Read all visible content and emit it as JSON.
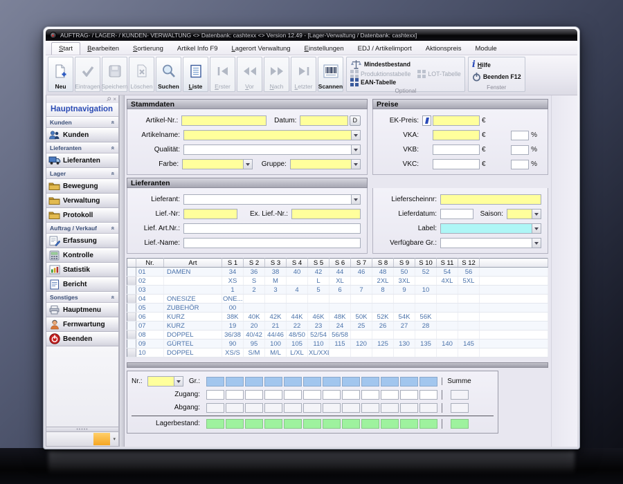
{
  "window": {
    "title": "AUFTRAG- / LAGER- / KUNDEN- VERWALTUNG <> Datenbank: cashtexx <> Version 12.49 - [Lager-Verwaltung / Datenbank: cashtexx]"
  },
  "ribbon": {
    "tabs": [
      {
        "label": "Start",
        "accel": true,
        "active": true
      },
      {
        "label": "Bearbeiten",
        "accel": true
      },
      {
        "label": "Sortierung",
        "accel": true
      },
      {
        "label": "Artikel Info F9"
      },
      {
        "label": "Lagerort Verwaltung",
        "accel": true
      },
      {
        "label": "Einstellungen",
        "accel": true
      },
      {
        "label": "EDJ / Artikelimport"
      },
      {
        "label": "Aktionspreis"
      },
      {
        "label": "Module"
      }
    ],
    "buttons": [
      {
        "label": "Neu",
        "icon": "new-page-icon",
        "enabled": true
      },
      {
        "label": "Eintragen",
        "icon": "checkmark-icon",
        "enabled": false
      },
      {
        "label": "Speichern",
        "icon": "floppy-icon",
        "enabled": false
      },
      {
        "label": "Löschen",
        "icon": "delete-page-icon",
        "enabled": false
      },
      {
        "label": "Suchen",
        "icon": "magnifier-icon",
        "enabled": true
      },
      {
        "label": "Liste",
        "icon": "list-icon",
        "enabled": true,
        "accel": true
      },
      {
        "label": "Erster",
        "icon": "first-icon",
        "enabled": false,
        "accel": true
      },
      {
        "label": "Vor",
        "icon": "prev-icon",
        "enabled": false,
        "accel": true
      },
      {
        "label": "Nach",
        "icon": "next-icon",
        "enabled": false,
        "accel": true
      },
      {
        "label": "Letzter",
        "icon": "last-icon",
        "enabled": false,
        "accel": true
      },
      {
        "label": "Scannen",
        "icon": "barcode-icon",
        "enabled": true
      }
    ],
    "optional_group": {
      "caption": "Optional",
      "items": [
        {
          "label": "Mindestbestand",
          "icon": "scale-icon",
          "enabled": true
        },
        {
          "label": "Produktionstabelle",
          "icon": "grid-icon",
          "enabled": false
        },
        {
          "label": "LOT-Tabelle",
          "icon": "grid-icon",
          "enabled": false
        },
        {
          "label": "EAN-Tabelle",
          "icon": "grid-icon",
          "enabled": true
        }
      ]
    },
    "fenster_group": {
      "caption": "Fenster",
      "items": [
        {
          "label": "Hilfe",
          "icon": "info-icon",
          "accel": true
        },
        {
          "label": "Beenden F12",
          "icon": "power-icon"
        }
      ]
    }
  },
  "sidebar": {
    "title": "Hauptnavigation",
    "groups": [
      {
        "label": "Kunden",
        "items": [
          {
            "label": "Kunden",
            "icon": "people-icon"
          }
        ]
      },
      {
        "label": "Lieferanten",
        "items": [
          {
            "label": "Lieferanten",
            "icon": "truck-icon"
          }
        ]
      },
      {
        "label": "Lager",
        "items": [
          {
            "label": "Bewegung",
            "icon": "folder-icon"
          },
          {
            "label": "Verwaltung",
            "icon": "folder-icon"
          },
          {
            "label": "Protokoll",
            "icon": "folder-icon"
          }
        ]
      },
      {
        "label": "Auftrag / Verkauf",
        "items": [
          {
            "label": "Erfassung",
            "icon": "note-icon"
          },
          {
            "label": "Kontrolle",
            "icon": "calculator-icon"
          },
          {
            "label": "Statistik",
            "icon": "chart-icon"
          },
          {
            "label": "Bericht",
            "icon": "report-icon"
          }
        ]
      },
      {
        "label": "Sonstiges",
        "items": [
          {
            "label": "Hauptmenu",
            "icon": "printer-icon"
          },
          {
            "label": "Fernwartung",
            "icon": "support-icon"
          },
          {
            "label": "Beenden",
            "icon": "power-red-icon"
          }
        ]
      }
    ]
  },
  "form": {
    "stammdaten": {
      "title": "Stammdaten",
      "artikel_nr_label": "Artikel-Nr.:",
      "datum_label": "Datum:",
      "datum_button": "D",
      "artikelname_label": "Artikelname:",
      "qualitaet_label": "Qualität:",
      "farbe_label": "Farbe:",
      "gruppe_label": "Gruppe:"
    },
    "preise": {
      "title": "Preise",
      "ek_label": "EK-Preis:",
      "vka_label": "VKA:",
      "vkb_label": "VKB:",
      "vkc_label": "VKC:",
      "currency": "€",
      "percent": "%"
    },
    "lieferanten": {
      "title": "Lieferanten",
      "lieferant_label": "Lieferant:",
      "lief_nr_label": "Lief.-Nr:",
      "ex_lief_nr_label": "Ex. Lief.-Nr.:",
      "lief_art_nr_label": "Lief. Art.Nr.:",
      "lief_name_label": "Lief.-Name:"
    },
    "liefer_details": {
      "lieferschein_label": "Lieferscheinnr:",
      "lieferdatum_label": "Lieferdatum:",
      "saison_label": "Saison:",
      "label_label": "Label:",
      "verfuegbare_label": "Verfügbare Gr.:"
    }
  },
  "table": {
    "columns": [
      "Nr.",
      "Art",
      "S 1",
      "S 2",
      "S 3",
      "S 4",
      "S 5",
      "S 6",
      "S 7",
      "S 8",
      "S 9",
      "S 10",
      "S 11",
      "S 12"
    ],
    "rows": [
      {
        "nr": "01",
        "art": "DAMEN",
        "sizes": [
          "34",
          "36",
          "38",
          "40",
          "42",
          "44",
          "46",
          "48",
          "50",
          "52",
          "54",
          "56"
        ]
      },
      {
        "nr": "02",
        "art": "",
        "sizes": [
          "XS",
          "S",
          "M",
          "",
          "L",
          "XL",
          "",
          "2XL",
          "3XL",
          "",
          "4XL",
          "5XL"
        ]
      },
      {
        "nr": "03",
        "art": "",
        "sizes": [
          "1",
          "2",
          "3",
          "4",
          "5",
          "6",
          "7",
          "8",
          "9",
          "10",
          "",
          ""
        ]
      },
      {
        "nr": "04",
        "art": "ONESIZE",
        "sizes": [
          "ONE...",
          "",
          "",
          "",
          "",
          "",
          "",
          "",
          "",
          "",
          "",
          ""
        ]
      },
      {
        "nr": "05",
        "art": "ZUBEHÖR",
        "sizes": [
          "00",
          "",
          "",
          "",
          "",
          "",
          "",
          "",
          "",
          "",
          "",
          ""
        ]
      },
      {
        "nr": "06",
        "art": "KURZ",
        "sizes": [
          "38K",
          "40K",
          "42K",
          "44K",
          "46K",
          "48K",
          "50K",
          "52K",
          "54K",
          "56K",
          "",
          ""
        ]
      },
      {
        "nr": "07",
        "art": "KURZ",
        "sizes": [
          "19",
          "20",
          "21",
          "22",
          "23",
          "24",
          "25",
          "26",
          "27",
          "28",
          "",
          ""
        ]
      },
      {
        "nr": "08",
        "art": "DOPPEL",
        "sizes": [
          "36/38",
          "40/42",
          "44/46",
          "48/50",
          "52/54",
          "56/58",
          "",
          "",
          "",
          "",
          "",
          ""
        ]
      },
      {
        "nr": "09",
        "art": "GÜRTEL",
        "sizes": [
          "90",
          "95",
          "100",
          "105",
          "110",
          "115",
          "120",
          "125",
          "130",
          "135",
          "140",
          "145"
        ]
      },
      {
        "nr": "10",
        "art": "DOPPEL",
        "sizes": [
          "XS/S",
          "S/M",
          "M/L",
          "L/XL",
          "XL/XXL",
          "",
          "",
          "",
          "",
          "",
          "",
          ""
        ]
      }
    ]
  },
  "bestand": {
    "nr_label": "Nr.:",
    "gr_label": "Gr.:",
    "zugang_label": "Zugang:",
    "abgang_label": "Abgang:",
    "lagerbestand_label": "Lagerbestand:",
    "summe_label": "Summe",
    "columns": 12
  },
  "colors": {
    "input_yellow": "#ffff9c",
    "input_cyan": "#aef6f6",
    "cell_blue": "#a2c6ee",
    "cell_green": "#9ef29e",
    "nav_title_blue": "#2b4bb4"
  }
}
